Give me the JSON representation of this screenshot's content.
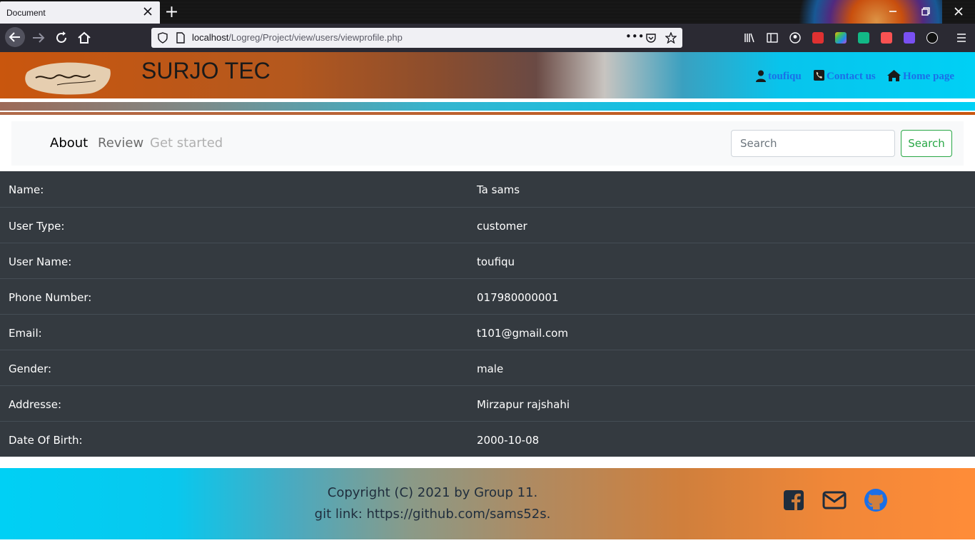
{
  "browser": {
    "tab_title": "Document",
    "url_host": "localhost",
    "url_path": "/Logreg/Project/view/users/viewprofile.php",
    "more_label": "•••"
  },
  "header": {
    "brand": "SURJO TEC",
    "links": [
      {
        "label": "toufiqu",
        "icon": "user-icon"
      },
      {
        "label": "Contact us",
        "icon": "phone-icon"
      },
      {
        "label": "Home page",
        "icon": "home-icon"
      }
    ],
    "link_color": "#1a6fe8"
  },
  "subnav": {
    "items": [
      {
        "label": "About",
        "state": "active"
      },
      {
        "label": "Review",
        "state": "normal"
      },
      {
        "label": "Get started",
        "state": "disabled"
      }
    ],
    "search_placeholder": "Search",
    "search_button": "Search",
    "accent": "#28a745"
  },
  "profile": {
    "rows": [
      {
        "label": "Name:",
        "value": "Ta sams"
      },
      {
        "label": "User Type:",
        "value": "customer"
      },
      {
        "label": "User Name:",
        "value": "toufiqu"
      },
      {
        "label": "Phone Number:",
        "value": "017980000001"
      },
      {
        "label": "Email:",
        "value": "t101@gmail.com"
      },
      {
        "label": "Gender:",
        "value": "male"
      },
      {
        "label": "Addresse:",
        "value": "Mirzapur rajshahi"
      },
      {
        "label": "Date Of Birth:",
        "value": "2000-10-08"
      }
    ]
  },
  "footer": {
    "copyright": "Copyright (C) 2021 by Group 11.",
    "git_link": "git link: https://github.com/sams52s.",
    "icons": [
      "facebook-icon",
      "mail-icon",
      "github-icon"
    ]
  }
}
